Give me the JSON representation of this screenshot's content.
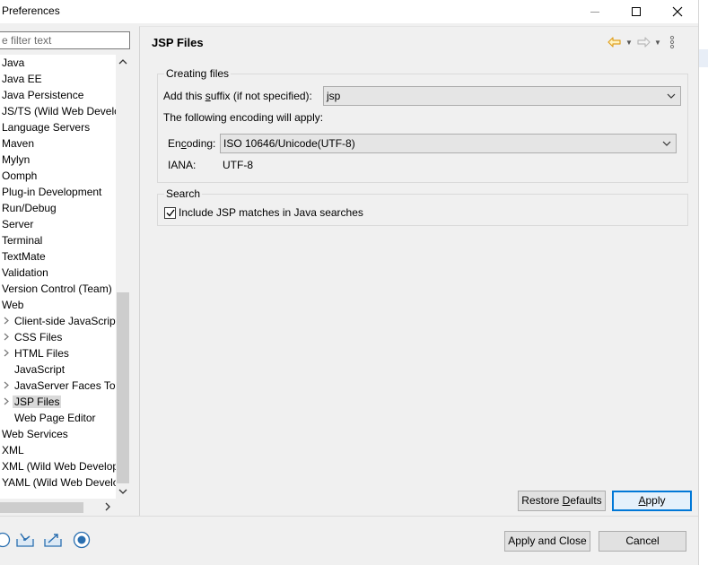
{
  "window": {
    "title": "Preferences"
  },
  "filter": {
    "placeholder": "e filter text"
  },
  "tree": {
    "items": [
      {
        "label": "Java",
        "has_children": false
      },
      {
        "label": "Java EE",
        "has_children": false
      },
      {
        "label": "Java Persistence",
        "has_children": false
      },
      {
        "label": "JS/TS (Wild Web Develo",
        "has_children": false
      },
      {
        "label": "Language Servers",
        "has_children": false
      },
      {
        "label": "Maven",
        "has_children": false
      },
      {
        "label": "Mylyn",
        "has_children": false
      },
      {
        "label": "Oomph",
        "has_children": false
      },
      {
        "label": "Plug-in Development",
        "has_children": false
      },
      {
        "label": "Run/Debug",
        "has_children": false
      },
      {
        "label": "Server",
        "has_children": false
      },
      {
        "label": "Terminal",
        "has_children": false
      },
      {
        "label": "TextMate",
        "has_children": false
      },
      {
        "label": "Validation",
        "has_children": false
      },
      {
        "label": "Version Control (Team)",
        "has_children": false
      },
      {
        "label": "Web",
        "has_children": false
      },
      {
        "label": "Client-side JavaScript",
        "has_children": true,
        "child": true
      },
      {
        "label": "CSS Files",
        "has_children": true,
        "child": true
      },
      {
        "label": "HTML Files",
        "has_children": true,
        "child": true
      },
      {
        "label": "JavaScript",
        "has_children": false,
        "child": true
      },
      {
        "label": "JavaServer Faces Too",
        "has_children": true,
        "child": true
      },
      {
        "label": "JSP Files",
        "has_children": true,
        "child": true,
        "selected": true
      },
      {
        "label": "Web Page Editor",
        "has_children": false,
        "child": true
      },
      {
        "label": "Web Services",
        "has_children": false
      },
      {
        "label": "XML",
        "has_children": false
      },
      {
        "label": "XML (Wild Web Develop",
        "has_children": false
      },
      {
        "label": "YAML (Wild Web Develo",
        "has_children": false
      }
    ]
  },
  "page": {
    "title": "JSP Files"
  },
  "creating_files": {
    "legend": "Creating files",
    "suffix_label_pre": "Add this ",
    "suffix_label_mnemonic": "s",
    "suffix_label_post": "uffix (if not specified):",
    "suffix_value": "jsp",
    "encoding_note": "The following encoding will apply:",
    "encoding_label_pre": "En",
    "encoding_label_mnemonic": "c",
    "encoding_label_post": "oding:",
    "encoding_value": "ISO 10646/Unicode(UTF-8)",
    "iana_label": "IANA:",
    "iana_value": "UTF-8"
  },
  "search": {
    "legend": "Search",
    "include_label": "Include JSP matches in Java searches",
    "include_checked": true
  },
  "buttons": {
    "restore_pre": "Restore ",
    "restore_mnemonic": "D",
    "restore_post": "efaults",
    "apply_mnemonic": "A",
    "apply_post": "pply",
    "apply_close": "Apply and Close",
    "cancel": "Cancel"
  },
  "colors": {
    "accent": "#0078d7",
    "back_arrow": "#e0a020"
  }
}
